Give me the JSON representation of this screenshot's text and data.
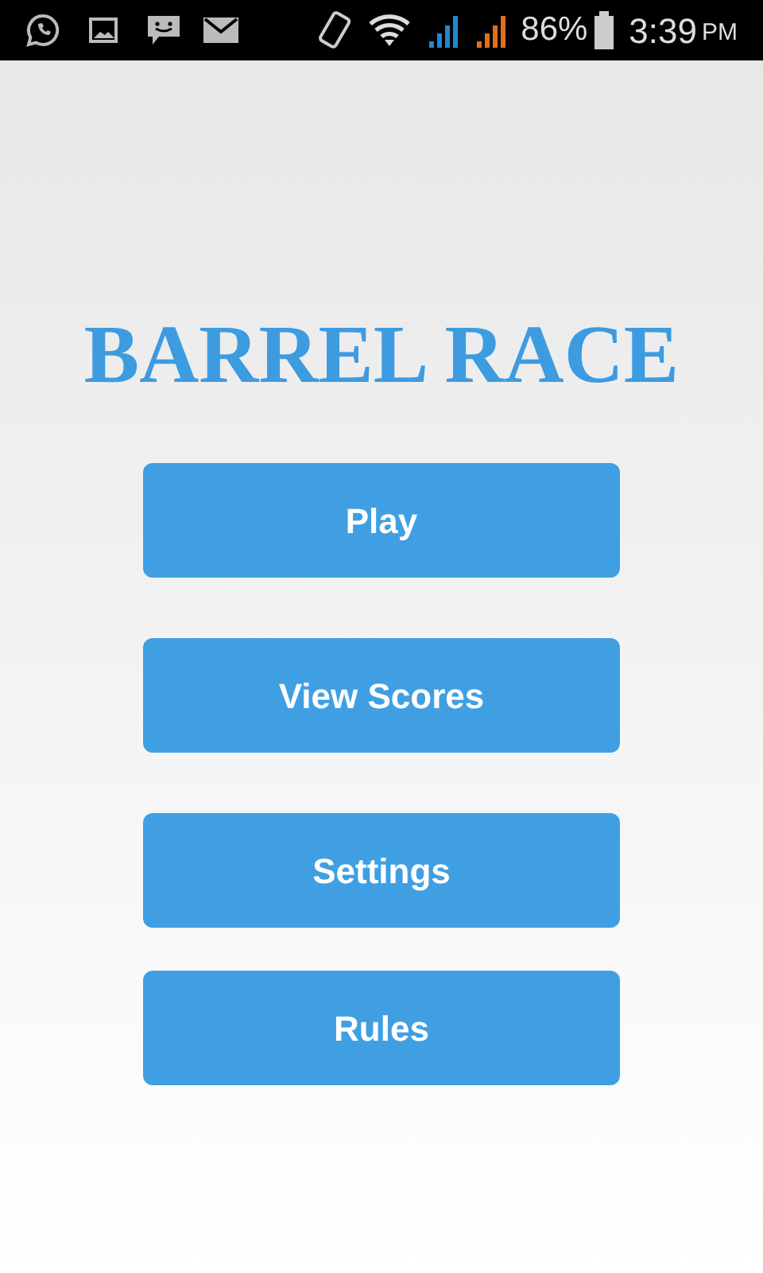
{
  "status_bar": {
    "battery": "86%",
    "time": "3:39",
    "meridiem": "PM"
  },
  "title": "BARREL RACE",
  "buttons": [
    "Play",
    "View Scores",
    "Settings",
    "Rules"
  ]
}
